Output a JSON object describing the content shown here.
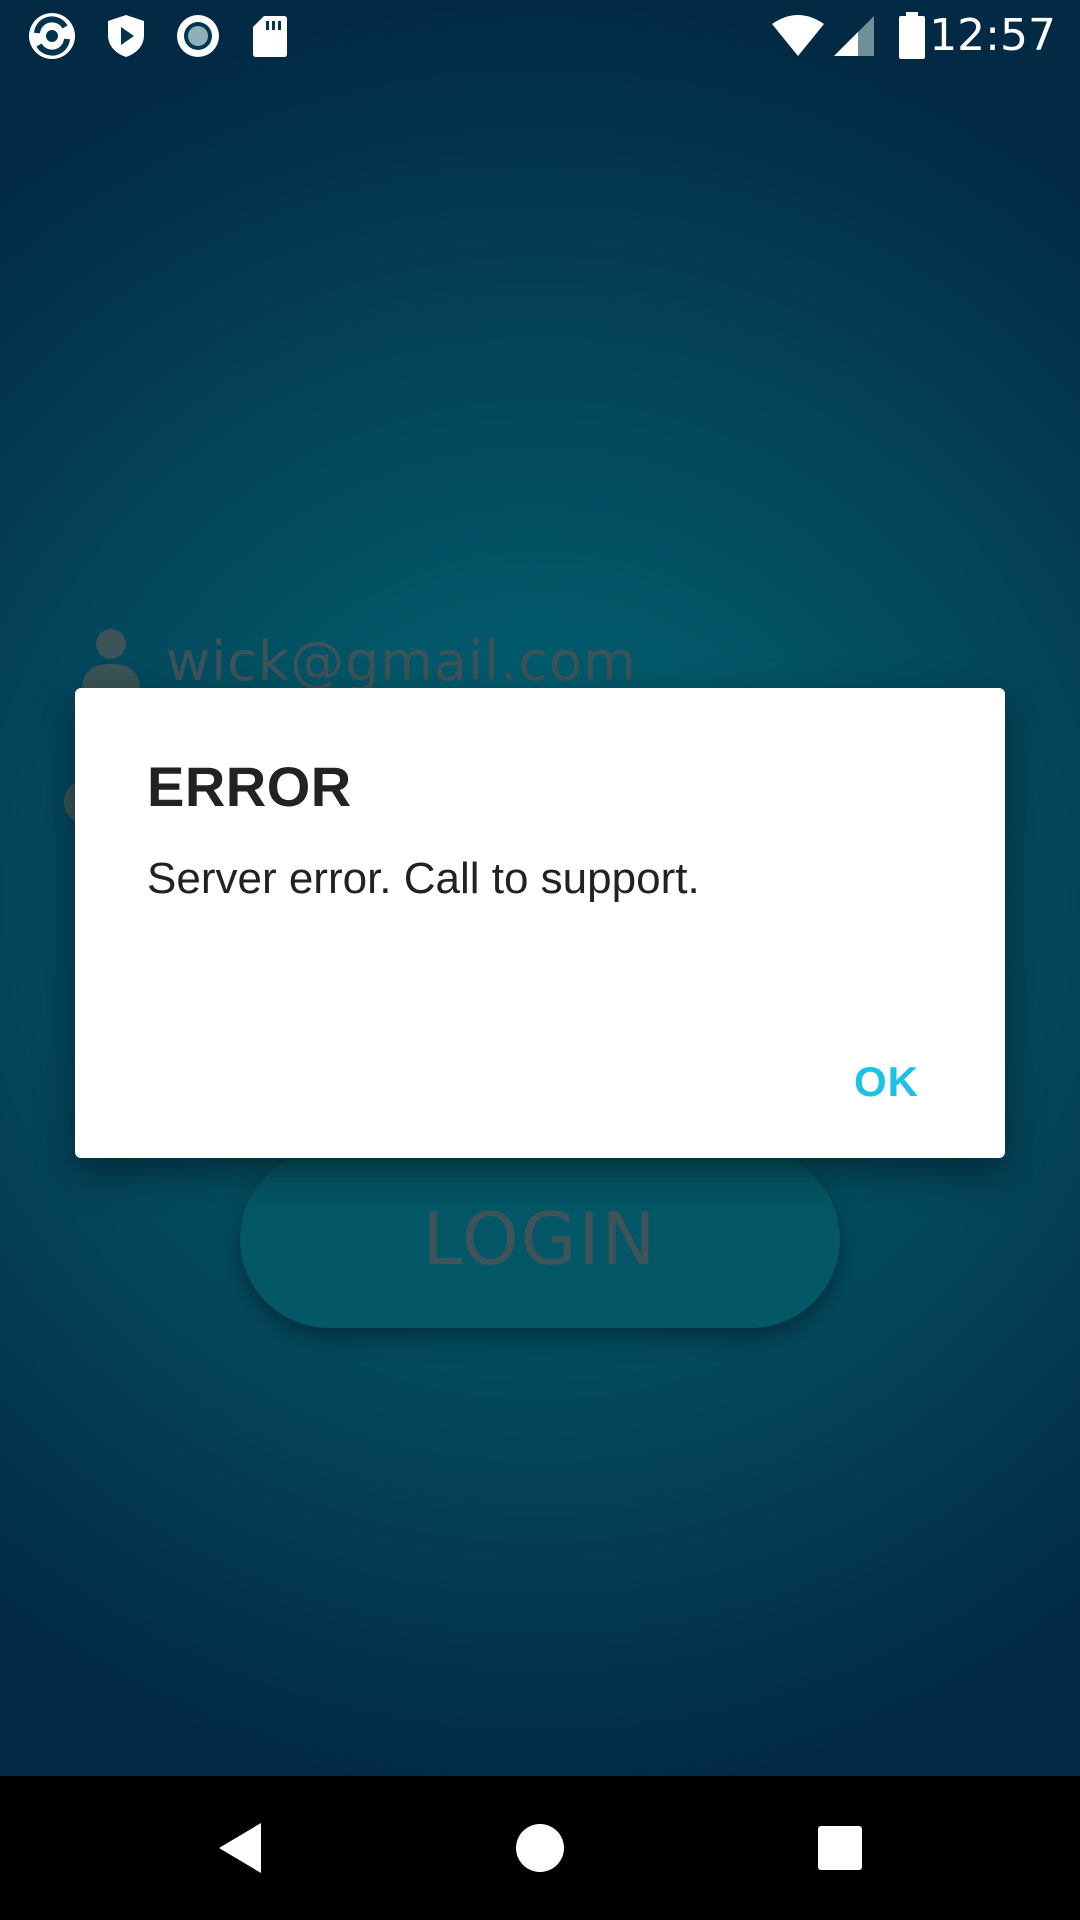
{
  "status_bar": {
    "time": "12:57",
    "left_icons": [
      "app-logo-icon",
      "shield-play-icon",
      "record-icon",
      "sd-card-icon"
    ],
    "right_icons": [
      "wifi-icon",
      "cell-signal-icon",
      "battery-icon"
    ]
  },
  "login": {
    "email_value": "wick@gmail.com",
    "login_label": "LOGIN"
  },
  "dialog": {
    "title": "ERROR",
    "message": "Server error. Call to support.",
    "ok_label": "OK"
  },
  "colors": {
    "background_top": "#032a45",
    "background_center": "#00697a",
    "dialog_accent": "#1cc2e4"
  }
}
